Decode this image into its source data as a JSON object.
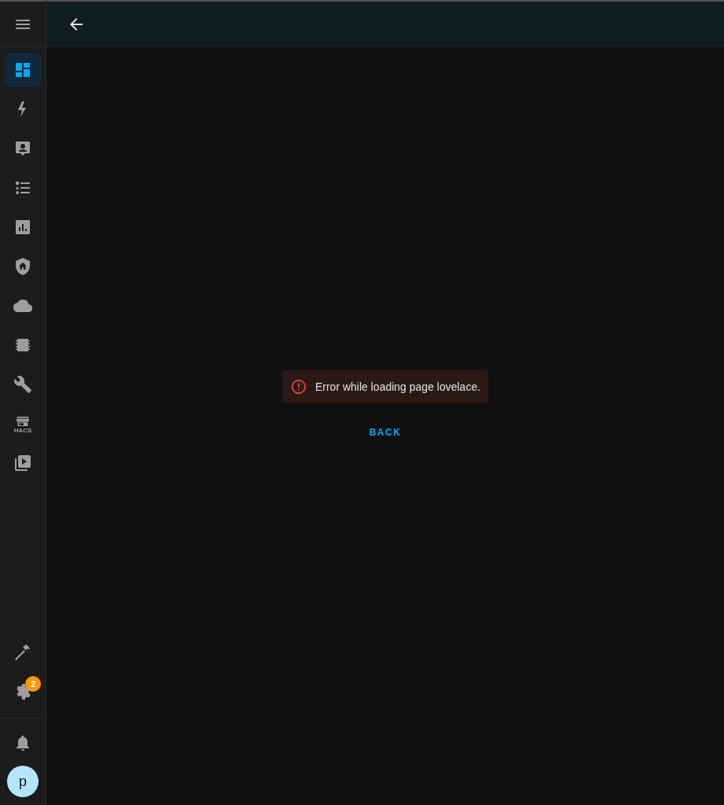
{
  "sidebar": {
    "items": [
      {
        "kind": "dashboard",
        "selected": true
      },
      {
        "kind": "energy",
        "selected": false
      },
      {
        "kind": "logbook",
        "selected": false
      },
      {
        "kind": "list",
        "selected": false
      },
      {
        "kind": "history",
        "selected": false
      },
      {
        "kind": "shield",
        "selected": false
      },
      {
        "kind": "cloud",
        "selected": false
      },
      {
        "kind": "chip",
        "selected": false
      },
      {
        "kind": "wrench",
        "selected": false
      },
      {
        "kind": "store",
        "selected": false,
        "label": "HACS"
      },
      {
        "kind": "media",
        "selected": false
      }
    ],
    "bottom_items": [
      {
        "kind": "hammer",
        "selected": false
      },
      {
        "kind": "gear",
        "selected": false,
        "badge": "2"
      }
    ],
    "notifications": {
      "kind": "bell"
    },
    "user": {
      "initial": "p"
    }
  },
  "error": {
    "message": "Error while loading page lovelace.",
    "button": "BACK"
  }
}
